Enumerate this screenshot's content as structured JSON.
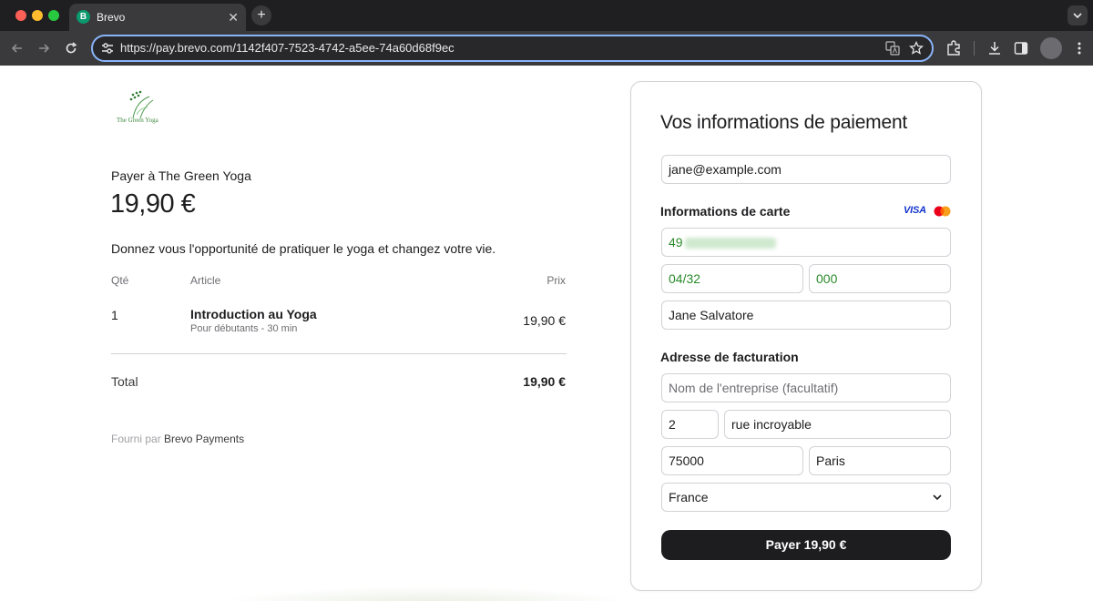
{
  "browser": {
    "tab_title": "Brevo",
    "tab_favicon_letter": "B",
    "tab_close": "✕",
    "new_tab": "+",
    "url": "https://pay.brevo.com/1142f407-7523-4742-a5ee-74a60d68f9ec"
  },
  "merchant": {
    "logo_text": "The Green Yoga",
    "pay_to": "Payer à The Green Yoga",
    "amount": "19,90 €",
    "description": "Donnez vous l'opportunité de pratiquer le yoga et changez votre vie."
  },
  "order": {
    "headers": {
      "qty": "Qté",
      "item": "Article",
      "price": "Prix"
    },
    "items": [
      {
        "qty": "1",
        "name": "Introduction au Yoga",
        "subtitle": "Pour débutants - 30 min",
        "price": "19,90 €"
      }
    ],
    "total_label": "Total",
    "total_value": "19,90 €"
  },
  "footer": {
    "powered_prefix": "Fourni par",
    "powered_brand": "Brevo Payments"
  },
  "payment": {
    "title": "Vos informations de paiement",
    "email": "jane@example.com",
    "card_section": "Informations de carte",
    "card_brand_visa": "VISA",
    "card_number_prefix": "49",
    "expiry": "04/32",
    "cvc": "000",
    "cardholder": "Jane Salvatore",
    "billing_section": "Adresse de facturation",
    "company_placeholder": "Nom de l'entreprise (facultatif)",
    "street_number": "2",
    "street": "rue incroyable",
    "postal_code": "75000",
    "city": "Paris",
    "country": "France",
    "pay_button": "Payer 19,90 €"
  },
  "colors": {
    "accent_green": "#2a8a2a",
    "pay_button": "#1d1d1f",
    "visa_blue": "#1434cb",
    "omnibox_focus": "#8ab4f8"
  },
  "icons": [
    "back-icon",
    "forward-icon",
    "reload-icon",
    "site-settings-icon",
    "translate-icon",
    "bookmark-star-icon",
    "extensions-icon",
    "download-icon",
    "side-panel-icon",
    "chevron-down-icon",
    "mastercard-icon"
  ]
}
